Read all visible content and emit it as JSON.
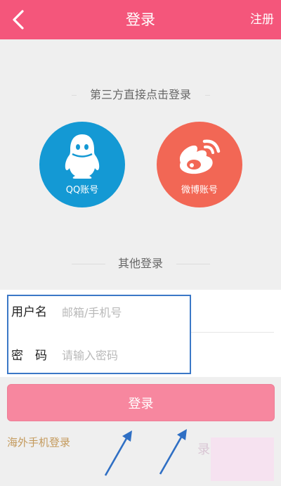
{
  "header": {
    "title": "登录",
    "register_label": "注册",
    "background": "#f4567b",
    "back_icon": "chevron-left-icon"
  },
  "third_party": {
    "heading": "第三方直接点击登录",
    "providers": [
      {
        "id": "qq",
        "label": "QQ账号",
        "color": "#1499d4",
        "icon": "qq-penguin-icon"
      },
      {
        "id": "weibo",
        "label": "微博账号",
        "color": "#f26755",
        "icon": "weibo-icon"
      }
    ]
  },
  "other_login": {
    "heading": "其他登录"
  },
  "form": {
    "username": {
      "label": "用户名",
      "placeholder": "邮箱/手机号",
      "value": ""
    },
    "password": {
      "label": "密　码",
      "placeholder": "请输入密码",
      "value": ""
    },
    "highlight_color": "#3b78c7"
  },
  "actions": {
    "login_label": "登录",
    "login_color": "#f7879f",
    "overseas_label": "海外手机登录",
    "overseas_color": "#c49a5c"
  },
  "annotations": {
    "arrow_color": "#2f6fc4",
    "arrow_icon": "arrow-up-right-icon"
  },
  "watermark": {
    "text": "录"
  }
}
